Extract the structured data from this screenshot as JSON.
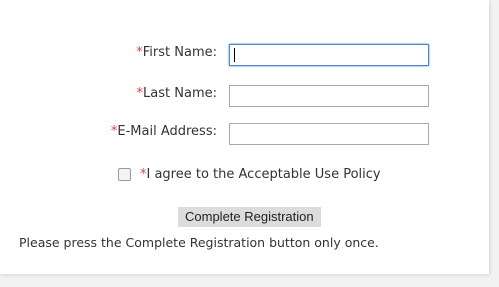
{
  "form": {
    "required_marker": "*",
    "first_name": {
      "label": "First Name:",
      "value": ""
    },
    "last_name": {
      "label": "Last Name:",
      "value": ""
    },
    "email": {
      "label": "E-Mail Address:",
      "value": ""
    },
    "agree": {
      "label": "I agree to the Acceptable Use Policy",
      "checked": false
    },
    "submit_label": "Complete Registration",
    "note": "Please press the Complete Registration button only once."
  },
  "colors": {
    "required": "#e0423c",
    "focus_border": "#4a86c8",
    "button_bg": "#dcdcdc"
  }
}
